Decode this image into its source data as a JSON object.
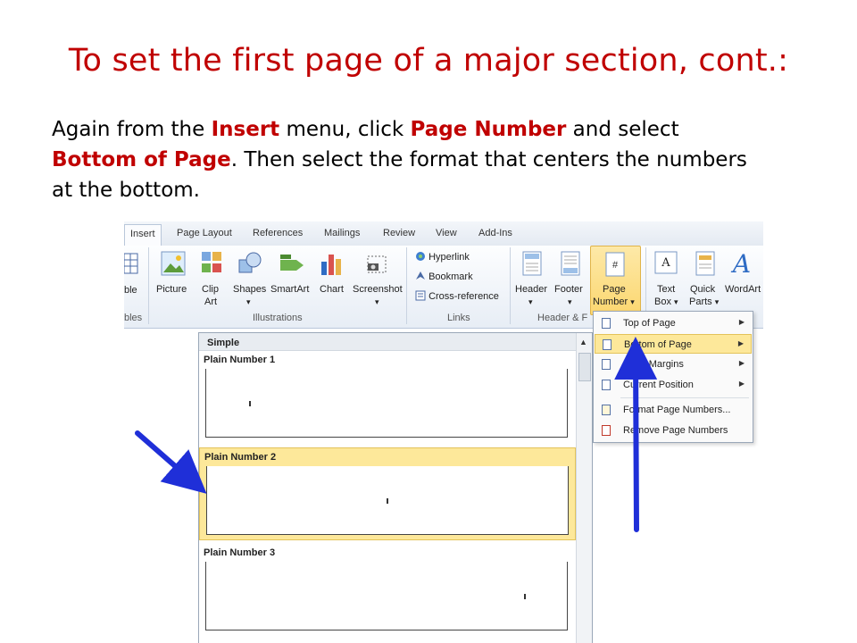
{
  "slide": {
    "title": "To set the first page of a major section, cont.:",
    "body": {
      "t1": "Again from the ",
      "k1": "Insert",
      "t2": " menu, click ",
      "k2": "Page Number",
      "t3": " and select ",
      "k3": "Bottom of Page",
      "t4": ".  Then select the format that centers the numbers at the bottom."
    }
  },
  "colors": {
    "accent": "#c00000",
    "highlight": "#fde89a",
    "arrow": "#1f2fd8"
  },
  "ribbon": {
    "tabs": [
      "Insert",
      "Page Layout",
      "References",
      "Mailings",
      "Review",
      "View",
      "Add-Ins"
    ],
    "illustrations": {
      "table_fragment": "ble",
      "picture": "Picture",
      "clip_art": [
        "Clip",
        "Art"
      ],
      "shapes": "Shapes",
      "smartart": "SmartArt",
      "chart": "Chart",
      "screenshot": "Screenshot"
    },
    "links": {
      "hyperlink": "Hyperlink",
      "bookmark": "Bookmark",
      "cross_reference": "Cross-reference"
    },
    "header_footer": {
      "header": "Header",
      "footer": "Footer",
      "page_number": [
        "Page",
        "Number"
      ]
    },
    "text": {
      "text_box": [
        "Text",
        "Box"
      ],
      "quick_parts": [
        "Quick",
        "Parts"
      ],
      "wordart": "WordArt"
    },
    "groups": {
      "tables_fragment": "bles",
      "illustrations": "Illustrations",
      "links": "Links",
      "header_footer": "Header & F"
    }
  },
  "gallery": {
    "section": "Simple",
    "items": [
      "Plain Number 1",
      "Plain Number 2",
      "Plain Number 3"
    ],
    "page_marker": "ı"
  },
  "dropdown": {
    "items": [
      "Top of Page",
      "Bottom of Page",
      "Page Margins",
      "Current Position",
      "Format Page Numbers...",
      "Remove Page Numbers"
    ],
    "arrow": "▶",
    "dropdown_marker": "▾"
  }
}
